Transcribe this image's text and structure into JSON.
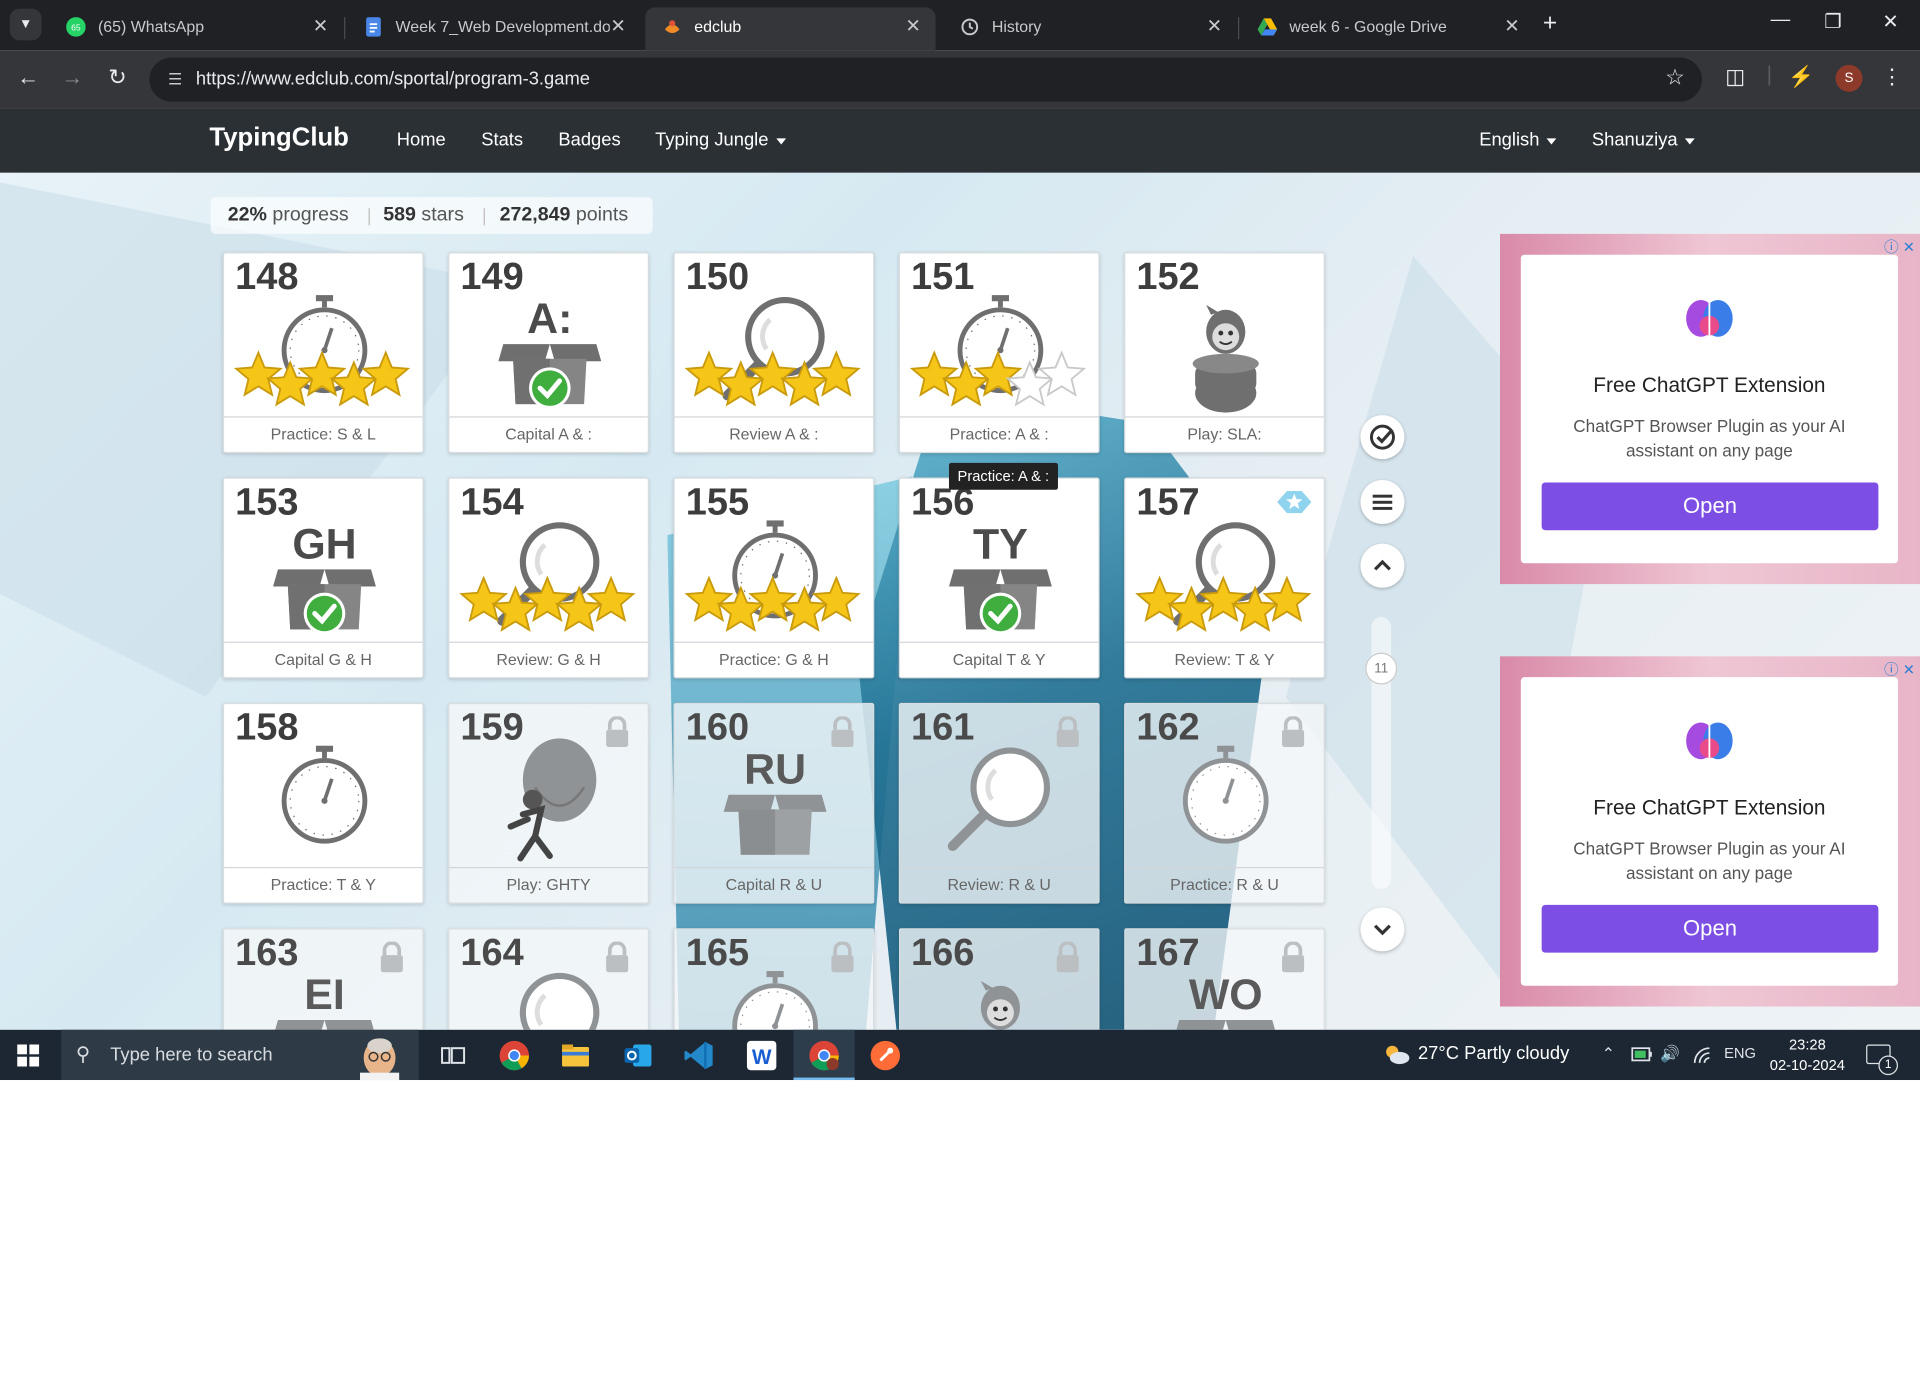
{
  "browser": {
    "tabs": [
      {
        "title": "(65) WhatsApp",
        "badge": "65",
        "color": "#25d366"
      },
      {
        "title": "Week 7_Web Development.docx",
        "color": "#4a86e8"
      },
      {
        "title": "edclub",
        "color": "#f08a24"
      },
      {
        "title": "History",
        "color": "#c7c9cc"
      },
      {
        "title": "week 6 - Google Drive",
        "color": "#34a853"
      }
    ],
    "url": "https://www.edclub.com/sportal/program-3.game",
    "profile_initial": "S"
  },
  "site": {
    "brand": "TypingClub",
    "nav": [
      "Home",
      "Stats",
      "Badges",
      "Typing Jungle"
    ],
    "language": "English",
    "user": "Shanuziya"
  },
  "progress": {
    "percent": "22%",
    "percent_label": "progress",
    "stars": "589",
    "stars_label": "stars",
    "points": "272,849",
    "points_label": "points"
  },
  "lessons": [
    {
      "num": "148",
      "label": "Practice: S & L",
      "icon": "stopwatch-icon",
      "stars": 5,
      "locked": false
    },
    {
      "num": "149",
      "label": "Capital A & :",
      "icon": "box-icon",
      "letters": "A:",
      "check": true,
      "locked": false
    },
    {
      "num": "150",
      "label": "Review A & :",
      "icon": "magnifier-icon",
      "stars": 5,
      "locked": false
    },
    {
      "num": "151",
      "label": "Practice: A & :",
      "icon": "stopwatch-icon",
      "stars": 3,
      "locked": false
    },
    {
      "num": "152",
      "label": "Play: SLA:",
      "icon": "game-character-icon",
      "locked": false
    },
    {
      "num": "153",
      "label": "Capital G & H",
      "icon": "box-icon",
      "letters": "GH",
      "check": true,
      "locked": false
    },
    {
      "num": "154",
      "label": "Review: G & H",
      "icon": "magnifier-icon",
      "stars": 5,
      "locked": false
    },
    {
      "num": "155",
      "label": "Practice: G & H",
      "icon": "stopwatch-icon",
      "stars": 5,
      "locked": false
    },
    {
      "num": "156",
      "label": "Capital T & Y",
      "icon": "box-icon",
      "letters": "TY",
      "check": true,
      "locked": false
    },
    {
      "num": "157",
      "label": "Review: T & Y",
      "icon": "magnifier-icon",
      "stars": 5,
      "badge": true,
      "locked": false
    },
    {
      "num": "158",
      "label": "Practice: T & Y",
      "icon": "stopwatch-icon",
      "locked": false
    },
    {
      "num": "159",
      "label": "Play: GHTY",
      "icon": "balloon-game-icon",
      "locked": true
    },
    {
      "num": "160",
      "label": "Capital R & U",
      "icon": "box-icon",
      "letters": "RU",
      "locked": true
    },
    {
      "num": "161",
      "label": "Review: R & U",
      "icon": "magnifier-icon",
      "locked": true
    },
    {
      "num": "162",
      "label": "Practice: R & U",
      "icon": "stopwatch-icon",
      "locked": true
    },
    {
      "num": "163",
      "label": "",
      "icon": "box-icon",
      "letters": "EI",
      "locked": true
    },
    {
      "num": "164",
      "label": "",
      "icon": "magnifier-icon",
      "locked": true
    },
    {
      "num": "165",
      "label": "",
      "icon": "stopwatch-icon",
      "locked": true
    },
    {
      "num": "166",
      "label": "",
      "icon": "game-character-icon",
      "locked": true
    },
    {
      "num": "167",
      "label": "",
      "icon": "box-icon",
      "letters": "WO",
      "locked": true
    }
  ],
  "tooltip": "Practice: A & :",
  "level_indicator": "11",
  "ads": [
    {
      "title": "Free ChatGPT Extension",
      "text": "ChatGPT Browser Plugin as your AI assistant on any page",
      "button": "Open"
    },
    {
      "title": "Free ChatGPT Extension",
      "text": "ChatGPT Browser Plugin as your AI assistant on any page",
      "button": "Open"
    }
  ],
  "taskbar": {
    "search_placeholder": "Type here to search",
    "weather": "27°C  Partly cloudy",
    "lang": "ENG",
    "time": "23:28",
    "date": "02-10-2024",
    "notifications": "1"
  }
}
